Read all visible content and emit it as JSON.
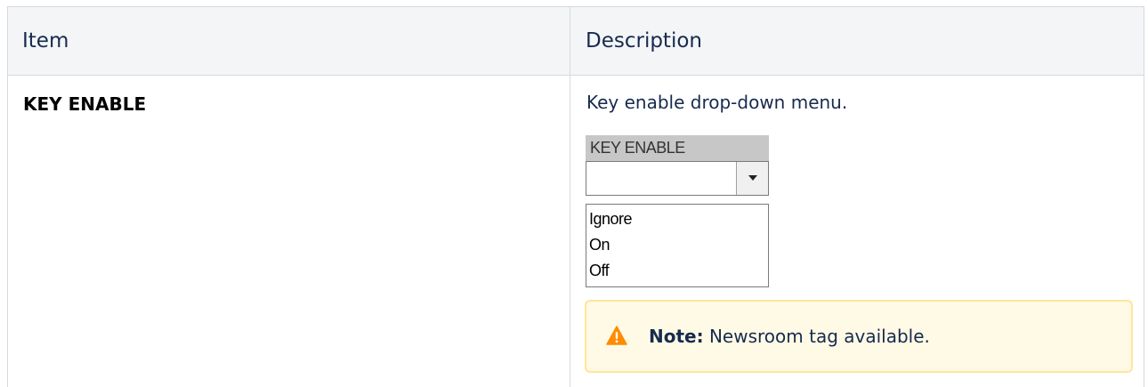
{
  "table": {
    "headers": {
      "item": "Item",
      "description": "Description"
    },
    "rows": [
      {
        "item": "KEY ENABLE",
        "description": "Key enable drop-down menu.",
        "widget": {
          "label": "KEY ENABLE",
          "selected_value": "",
          "options": [
            "Ignore",
            "On",
            "Off"
          ]
        },
        "note": {
          "label": "Note:",
          "text": "Newsroom tag available."
        }
      }
    ]
  },
  "colors": {
    "header_bg": "#f4f5f7",
    "border": "#d5d9de",
    "note_bg": "#fffae6",
    "note_border": "#ffe59a",
    "warning_icon": "#ff8b00"
  },
  "icons": {
    "note": "warning-icon",
    "dropdown": "chevron-down-icon"
  }
}
